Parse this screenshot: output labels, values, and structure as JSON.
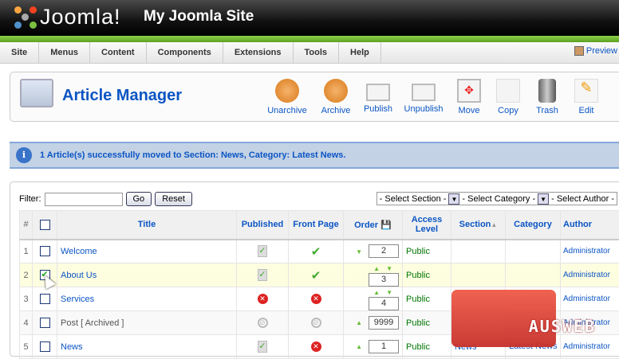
{
  "header": {
    "logo": "Joomla!",
    "site_name": "My Joomla Site"
  },
  "menu": [
    "Site",
    "Menus",
    "Content",
    "Components",
    "Extensions",
    "Tools",
    "Help"
  ],
  "preview": "Preview",
  "toolbar": {
    "title": "Article Manager",
    "buttons": [
      {
        "label": "Unarchive",
        "icon": "unarchive-icon"
      },
      {
        "label": "Archive",
        "icon": "archive-icon"
      },
      {
        "label": "Publish",
        "icon": "publish-icon"
      },
      {
        "label": "Unpublish",
        "icon": "unpublish-icon"
      },
      {
        "label": "Move",
        "icon": "move-icon"
      },
      {
        "label": "Copy",
        "icon": "copy-icon"
      },
      {
        "label": "Trash",
        "icon": "trash-icon"
      },
      {
        "label": "Edit",
        "icon": "edit-icon"
      }
    ]
  },
  "message": "1 Article(s) successfully moved to Section: News, Category: Latest News.",
  "filter": {
    "label": "Filter:",
    "value": "",
    "go": "Go",
    "reset": "Reset",
    "section": "- Select Section -",
    "category": "- Select Category -",
    "author": "- Select Author -"
  },
  "table": {
    "headers": {
      "num": "#",
      "title": "Title",
      "published": "Published",
      "front": "Front Page",
      "order": "Order",
      "access": "Access Level",
      "section": "Section",
      "category": "Category",
      "author": "Author"
    },
    "rows": [
      {
        "num": "1",
        "title": "Welcome",
        "checked": false,
        "published": "yes",
        "front": "yes",
        "order": "2",
        "access": "Public",
        "section": "",
        "category": "",
        "author": "Administrator"
      },
      {
        "num": "2",
        "title": "About Us",
        "checked": true,
        "published": "yes",
        "front": "yes",
        "order": "3",
        "access": "Public",
        "section": "",
        "category": "",
        "author": "Administrator"
      },
      {
        "num": "3",
        "title": "Services",
        "checked": false,
        "published": "no",
        "front": "no",
        "order": "4",
        "access": "Public",
        "section": "",
        "category": "",
        "author": "Administrator"
      },
      {
        "num": "4",
        "title": "Post [ Archived ]",
        "checked": false,
        "published": "archived",
        "front": "archived",
        "order": "9999",
        "access": "Public",
        "section": "",
        "category": "",
        "author": "Administrator"
      },
      {
        "num": "5",
        "title": "News",
        "checked": false,
        "published": "yes",
        "front": "no",
        "order": "1",
        "access": "Public",
        "section": "News",
        "category": "Latest News",
        "author": "Administrator"
      }
    ]
  },
  "watermark": "AUSWEB"
}
